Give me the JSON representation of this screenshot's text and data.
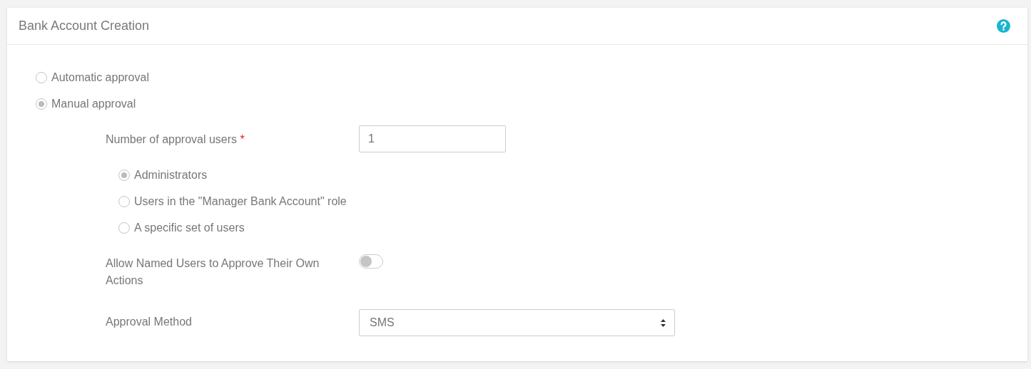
{
  "panel": {
    "title": "Bank Account Creation"
  },
  "approval_modes": [
    {
      "label": "Automatic approval",
      "selected": false
    },
    {
      "label": "Manual approval",
      "selected": true
    }
  ],
  "manual": {
    "count_field": {
      "label": "Number of approval users",
      "required_mark": "*",
      "value": "1"
    },
    "approvers": [
      {
        "label": "Administrators",
        "selected": true
      },
      {
        "label": "Users in the \"Manager Bank Account\" role",
        "selected": false
      },
      {
        "label": "A specific set of users",
        "selected": false
      }
    ],
    "self_approval": {
      "label": "Allow Named Users to Approve Their Own Actions",
      "on": false
    },
    "method": {
      "label": "Approval Method",
      "value": "SMS"
    }
  }
}
